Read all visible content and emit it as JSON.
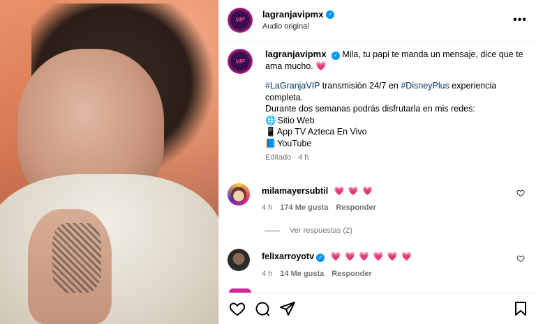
{
  "post": {
    "username": "lagranjavipmx",
    "subtitle": "Audio original",
    "avatar_text": "VIP",
    "more_label": "•••"
  },
  "caption": {
    "username": "lagranjavipmx",
    "text_line1": "Mila, tu papi te manda un mensaje, dice que te ama mucho.",
    "heart": "💗",
    "hashtag1": "#LaGranjaVIP",
    "text_mid": " transmisión 24/7 en ",
    "hashtag2": "#DisneyPlus",
    "text_end": " experiencia completa.",
    "line_two_weeks": "Durante dos semanas podrás disfrutarla en mis redes:",
    "item1_icon": "🌐",
    "item1": "Sitio Web",
    "item2_icon": "📱",
    "item2": "App TV Azteca En Vivo",
    "item3_icon": "📘",
    "item3": "YouTube",
    "meta": "Editado · 4 h"
  },
  "comments": [
    {
      "username": "milamayersubtil",
      "hearts": "💗 💗 💗",
      "time": "4 h",
      "likes": "174 Me gusta",
      "reply": "Responder"
    },
    {
      "username": "felixarroyotv",
      "hearts": "💗 💗 💗 💗 💗 💗",
      "time": "4 h",
      "likes": "14 Me gusta",
      "reply": "Responder"
    }
  ],
  "view_replies": "Ver respuestas (2)",
  "colors": {
    "accent_blue": "#0095f6",
    "link": "#00376b",
    "heart": "#ed4956",
    "muted": "#737373"
  }
}
